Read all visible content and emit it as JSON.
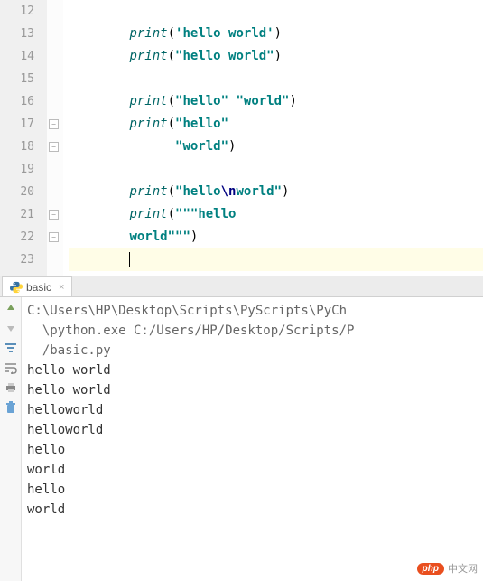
{
  "editor": {
    "line_numbers": [
      "12",
      "13",
      "14",
      "15",
      "16",
      "17",
      "18",
      "19",
      "20",
      "21",
      "22",
      "23"
    ],
    "lines": [
      {
        "indent": "        ",
        "segments": []
      },
      {
        "indent": "        ",
        "segments": [
          {
            "t": "func",
            "v": "print"
          },
          {
            "t": "paren",
            "v": "("
          },
          {
            "t": "str",
            "v": "'hello world'"
          },
          {
            "t": "paren",
            "v": ")"
          }
        ]
      },
      {
        "indent": "        ",
        "segments": [
          {
            "t": "func",
            "v": "print"
          },
          {
            "t": "paren",
            "v": "("
          },
          {
            "t": "str",
            "v": "\"hello world\""
          },
          {
            "t": "paren",
            "v": ")"
          }
        ]
      },
      {
        "indent": "",
        "segments": []
      },
      {
        "indent": "        ",
        "segments": [
          {
            "t": "func",
            "v": "print"
          },
          {
            "t": "paren",
            "v": "("
          },
          {
            "t": "str",
            "v": "\"hello\""
          },
          {
            "t": "plain",
            "v": " "
          },
          {
            "t": "str",
            "v": "\"world\""
          },
          {
            "t": "paren",
            "v": ")"
          }
        ]
      },
      {
        "indent": "        ",
        "segments": [
          {
            "t": "func",
            "v": "print"
          },
          {
            "t": "paren",
            "v": "("
          },
          {
            "t": "str",
            "v": "\"hello\""
          }
        ]
      },
      {
        "indent": "              ",
        "segments": [
          {
            "t": "str",
            "v": "\"world\""
          },
          {
            "t": "paren",
            "v": ")"
          }
        ]
      },
      {
        "indent": "",
        "segments": []
      },
      {
        "indent": "        ",
        "segments": [
          {
            "t": "func",
            "v": "print"
          },
          {
            "t": "paren",
            "v": "("
          },
          {
            "t": "str",
            "v": "\"hello"
          },
          {
            "t": "esc",
            "v": "\\n"
          },
          {
            "t": "str",
            "v": "world\""
          },
          {
            "t": "paren",
            "v": ")"
          }
        ]
      },
      {
        "indent": "        ",
        "segments": [
          {
            "t": "func",
            "v": "print"
          },
          {
            "t": "paren",
            "v": "("
          },
          {
            "t": "str",
            "v": "\"\"\"hello"
          }
        ]
      },
      {
        "indent": "        ",
        "segments": [
          {
            "t": "str",
            "v": "world\"\"\""
          },
          {
            "t": "paren",
            "v": ")"
          }
        ]
      },
      {
        "indent": "        ",
        "segments": [],
        "caret": true
      }
    ],
    "fold_markers": [
      {
        "line": 5,
        "sym": "⊖"
      },
      {
        "line": 6,
        "sym": "⊟"
      },
      {
        "line": 9,
        "sym": "⊖"
      },
      {
        "line": 10,
        "sym": "⊟"
      }
    ]
  },
  "tab": {
    "label": "basic",
    "close_glyph": "×"
  },
  "console": {
    "path_line1": "C:\\Users\\HP\\Desktop\\Scripts\\PyScripts\\PyCh",
    "path_line2": "  \\python.exe C:/Users/HP/Desktop/Scripts/P",
    "path_line3": "  /basic.py",
    "output": [
      "hello world",
      "hello world",
      "helloworld",
      "helloworld",
      "hello",
      "world",
      "hello",
      "world"
    ]
  },
  "watermark": {
    "badge": "php",
    "text": "中文网"
  }
}
